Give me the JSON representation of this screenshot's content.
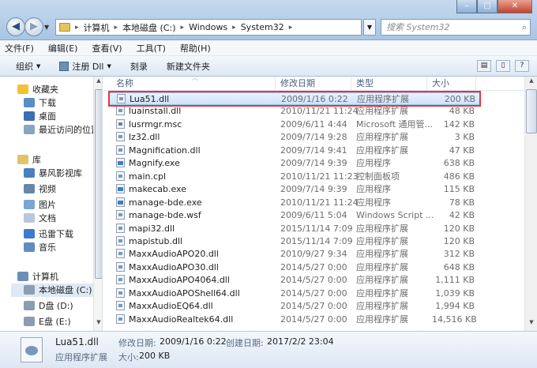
{
  "address": {
    "path": [
      "计算机",
      "本地磁盘 (C:)",
      "Windows",
      "System32"
    ]
  },
  "search": {
    "placeholder": "搜索 System32"
  },
  "window_buttons": {
    "min": "–",
    "max": "□",
    "close": "✕"
  },
  "menu": [
    "文件(F)",
    "编辑(E)",
    "查看(V)",
    "工具(T)",
    "帮助(H)"
  ],
  "toolbar": {
    "organize": "组织",
    "register": "注册 Dll",
    "burn": "刻录",
    "new_folder": "新建文件夹"
  },
  "nav": {
    "favorites": "收藏夹",
    "downloads": "下载",
    "desktop": "桌面",
    "recent": "最近访问的位置",
    "libraries": "库",
    "video_lib": "暴风影视库",
    "videos": "视频",
    "pictures": "图片",
    "documents": "文档",
    "thunder": "迅雷下载",
    "music": "音乐",
    "computer": "计算机",
    "drive_c": "本地磁盘 (C:)",
    "drive_d": "D盘 (D:)",
    "drive_e": "E盘 (E:)"
  },
  "columns": {
    "name": "名称",
    "date": "修改日期",
    "type": "类型",
    "size": "大小"
  },
  "files": [
    {
      "name": "Lua51.dll",
      "date": "2009/1/16 0:22",
      "type": "应用程序扩展",
      "size": "200 KB",
      "icon": "dll"
    },
    {
      "name": "luainstall.dll",
      "date": "2010/11/21 11:24",
      "type": "应用程序扩展",
      "size": "48 KB",
      "icon": "dll"
    },
    {
      "name": "lusrmgr.msc",
      "date": "2009/6/11 4:44",
      "type": "Microsoft 通用管...",
      "size": "142 KB",
      "icon": "msc"
    },
    {
      "name": "lz32.dll",
      "date": "2009/7/14 9:28",
      "type": "应用程序扩展",
      "size": "3 KB",
      "icon": "dll"
    },
    {
      "name": "Magnification.dll",
      "date": "2009/7/14 9:41",
      "type": "应用程序扩展",
      "size": "47 KB",
      "icon": "dll"
    },
    {
      "name": "Magnify.exe",
      "date": "2009/7/14 9:39",
      "type": "应用程序",
      "size": "638 KB",
      "icon": "exe"
    },
    {
      "name": "main.cpl",
      "date": "2010/11/21 11:23",
      "type": "控制面板项",
      "size": "486 KB",
      "icon": "cpl"
    },
    {
      "name": "makecab.exe",
      "date": "2009/7/14 9:39",
      "type": "应用程序",
      "size": "115 KB",
      "icon": "exe"
    },
    {
      "name": "manage-bde.exe",
      "date": "2010/11/21 11:24",
      "type": "应用程序",
      "size": "78 KB",
      "icon": "exe"
    },
    {
      "name": "manage-bde.wsf",
      "date": "2009/6/11 5:04",
      "type": "Windows Script ...",
      "size": "42 KB",
      "icon": "wsf"
    },
    {
      "name": "mapi32.dll",
      "date": "2015/11/14 7:09",
      "type": "应用程序扩展",
      "size": "120 KB",
      "icon": "dll"
    },
    {
      "name": "mapistub.dll",
      "date": "2015/11/14 7:09",
      "type": "应用程序扩展",
      "size": "120 KB",
      "icon": "dll"
    },
    {
      "name": "MaxxAudioAPO20.dll",
      "date": "2010/9/27 9:34",
      "type": "应用程序扩展",
      "size": "312 KB",
      "icon": "dll"
    },
    {
      "name": "MaxxAudioAPO30.dll",
      "date": "2014/5/27 0:00",
      "type": "应用程序扩展",
      "size": "648 KB",
      "icon": "dll"
    },
    {
      "name": "MaxxAudioAPO4064.dll",
      "date": "2014/5/27 0:00",
      "type": "应用程序扩展",
      "size": "1,111 KB",
      "icon": "dll"
    },
    {
      "name": "MaxxAudioAPOShell64.dll",
      "date": "2014/5/27 0:00",
      "type": "应用程序扩展",
      "size": "1,039 KB",
      "icon": "dll"
    },
    {
      "name": "MaxxAudioEQ64.dll",
      "date": "2014/5/27 0:00",
      "type": "应用程序扩展",
      "size": "1,994 KB",
      "icon": "dll"
    },
    {
      "name": "MaxxAudioRealtek64.dll",
      "date": "2014/5/27 0:00",
      "type": "应用程序扩展",
      "size": "14,516 KB",
      "icon": "dll"
    }
  ],
  "details": {
    "name": "Lua51.dll",
    "type": "应用程序扩展",
    "modified_label": "修改日期:",
    "modified": "2009/1/16 0:22",
    "created_label": "创建日期:",
    "created": "2017/2/2 23:04",
    "size_label": "大小:",
    "size": "200 KB"
  },
  "colors": {
    "selection_border": "#e0393d",
    "accent": "#3f7fc7"
  }
}
